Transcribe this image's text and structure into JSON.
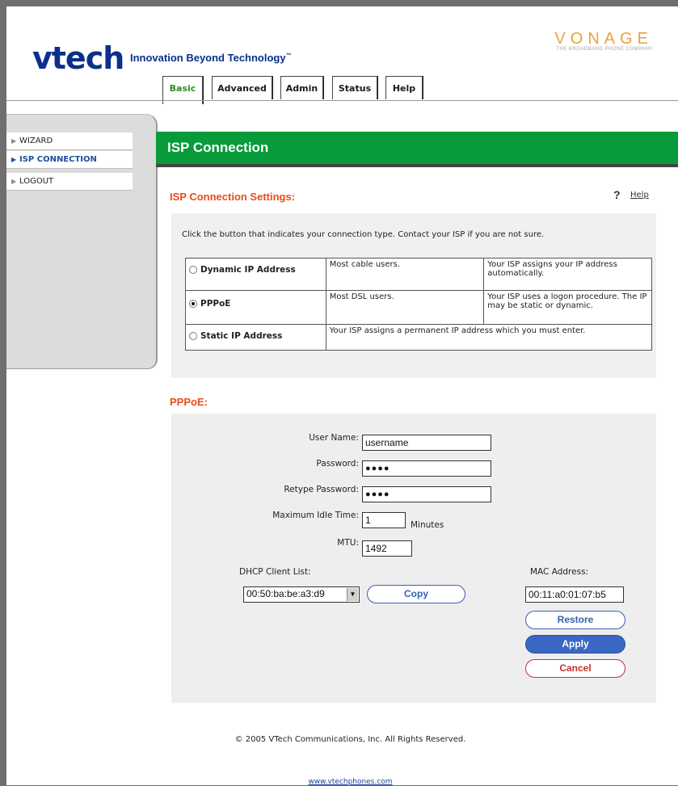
{
  "header": {
    "logo": "vtech",
    "tagline": "Innovation Beyond Technology",
    "tagline_mark": "™",
    "partner_brand": "VONAGE",
    "partner_subtitle": "THE BROADBAND PHONE COMPANY"
  },
  "tabs": [
    {
      "label": "Basic",
      "active": true
    },
    {
      "label": "Advanced",
      "active": false
    },
    {
      "label": "Admin",
      "active": false
    },
    {
      "label": "Status",
      "active": false
    },
    {
      "label": "Help",
      "active": false
    }
  ],
  "sidebar": {
    "items": [
      {
        "label": "WIZARD",
        "active": false
      },
      {
        "label": "ISP CONNECTION",
        "active": true
      },
      {
        "label": "LOGOUT",
        "active": false
      }
    ]
  },
  "page": {
    "title": "ISP Connection",
    "section_title": "ISP Connection Settings:",
    "help_icon": "?",
    "help_label": "Help",
    "instructions": "Click the button that indicates your connection type. Contact your ISP if you are not sure."
  },
  "connection_types": [
    {
      "label": "Dynamic IP Address",
      "selected": false,
      "desc1": "Most cable users.",
      "desc2": "Your ISP assigns your IP address automatically."
    },
    {
      "label": "PPPoE",
      "selected": true,
      "desc1": "Most DSL users.",
      "desc2": "Your ISP uses a logon procedure. The IP may be static or dynamic."
    },
    {
      "label": "Static IP Address",
      "selected": false,
      "desc": "Your ISP assigns a permanent IP address which you must enter."
    }
  ],
  "pppoe": {
    "title": "PPPoE:",
    "username_label": "User Name:",
    "username_value": "username",
    "password_label": "Password:",
    "password_value": "●●●●",
    "retype_label": "Retype Password:",
    "retype_value": "●●●●",
    "idle_label": "Maximum Idle Time:",
    "idle_value": "1",
    "idle_unit": "Minutes",
    "mtu_label": "MTU:",
    "mtu_value": "1492",
    "dhcp_label": "DHCP Client List:",
    "dhcp_selected": "00:50:ba:be:a3:d9",
    "copy_label": "Copy",
    "mac_label": "MAC Address:",
    "mac_value": "00:11:a0:01:07:b5",
    "restore_label": "Restore",
    "apply_label": "Apply",
    "cancel_label": "Cancel"
  },
  "footer": {
    "copyright": "© 2005 VTech Communications, Inc. All Rights Reserved.",
    "link": "www.vtechphones.com"
  },
  "colors": {
    "brand_blue": "#0b2f8b",
    "green_bar": "#079b3a",
    "section_orange": "#ea4c18",
    "vonage_orange": "#e9a23b",
    "apply_blue": "#3b67c4",
    "cancel_red": "#c5302c"
  }
}
